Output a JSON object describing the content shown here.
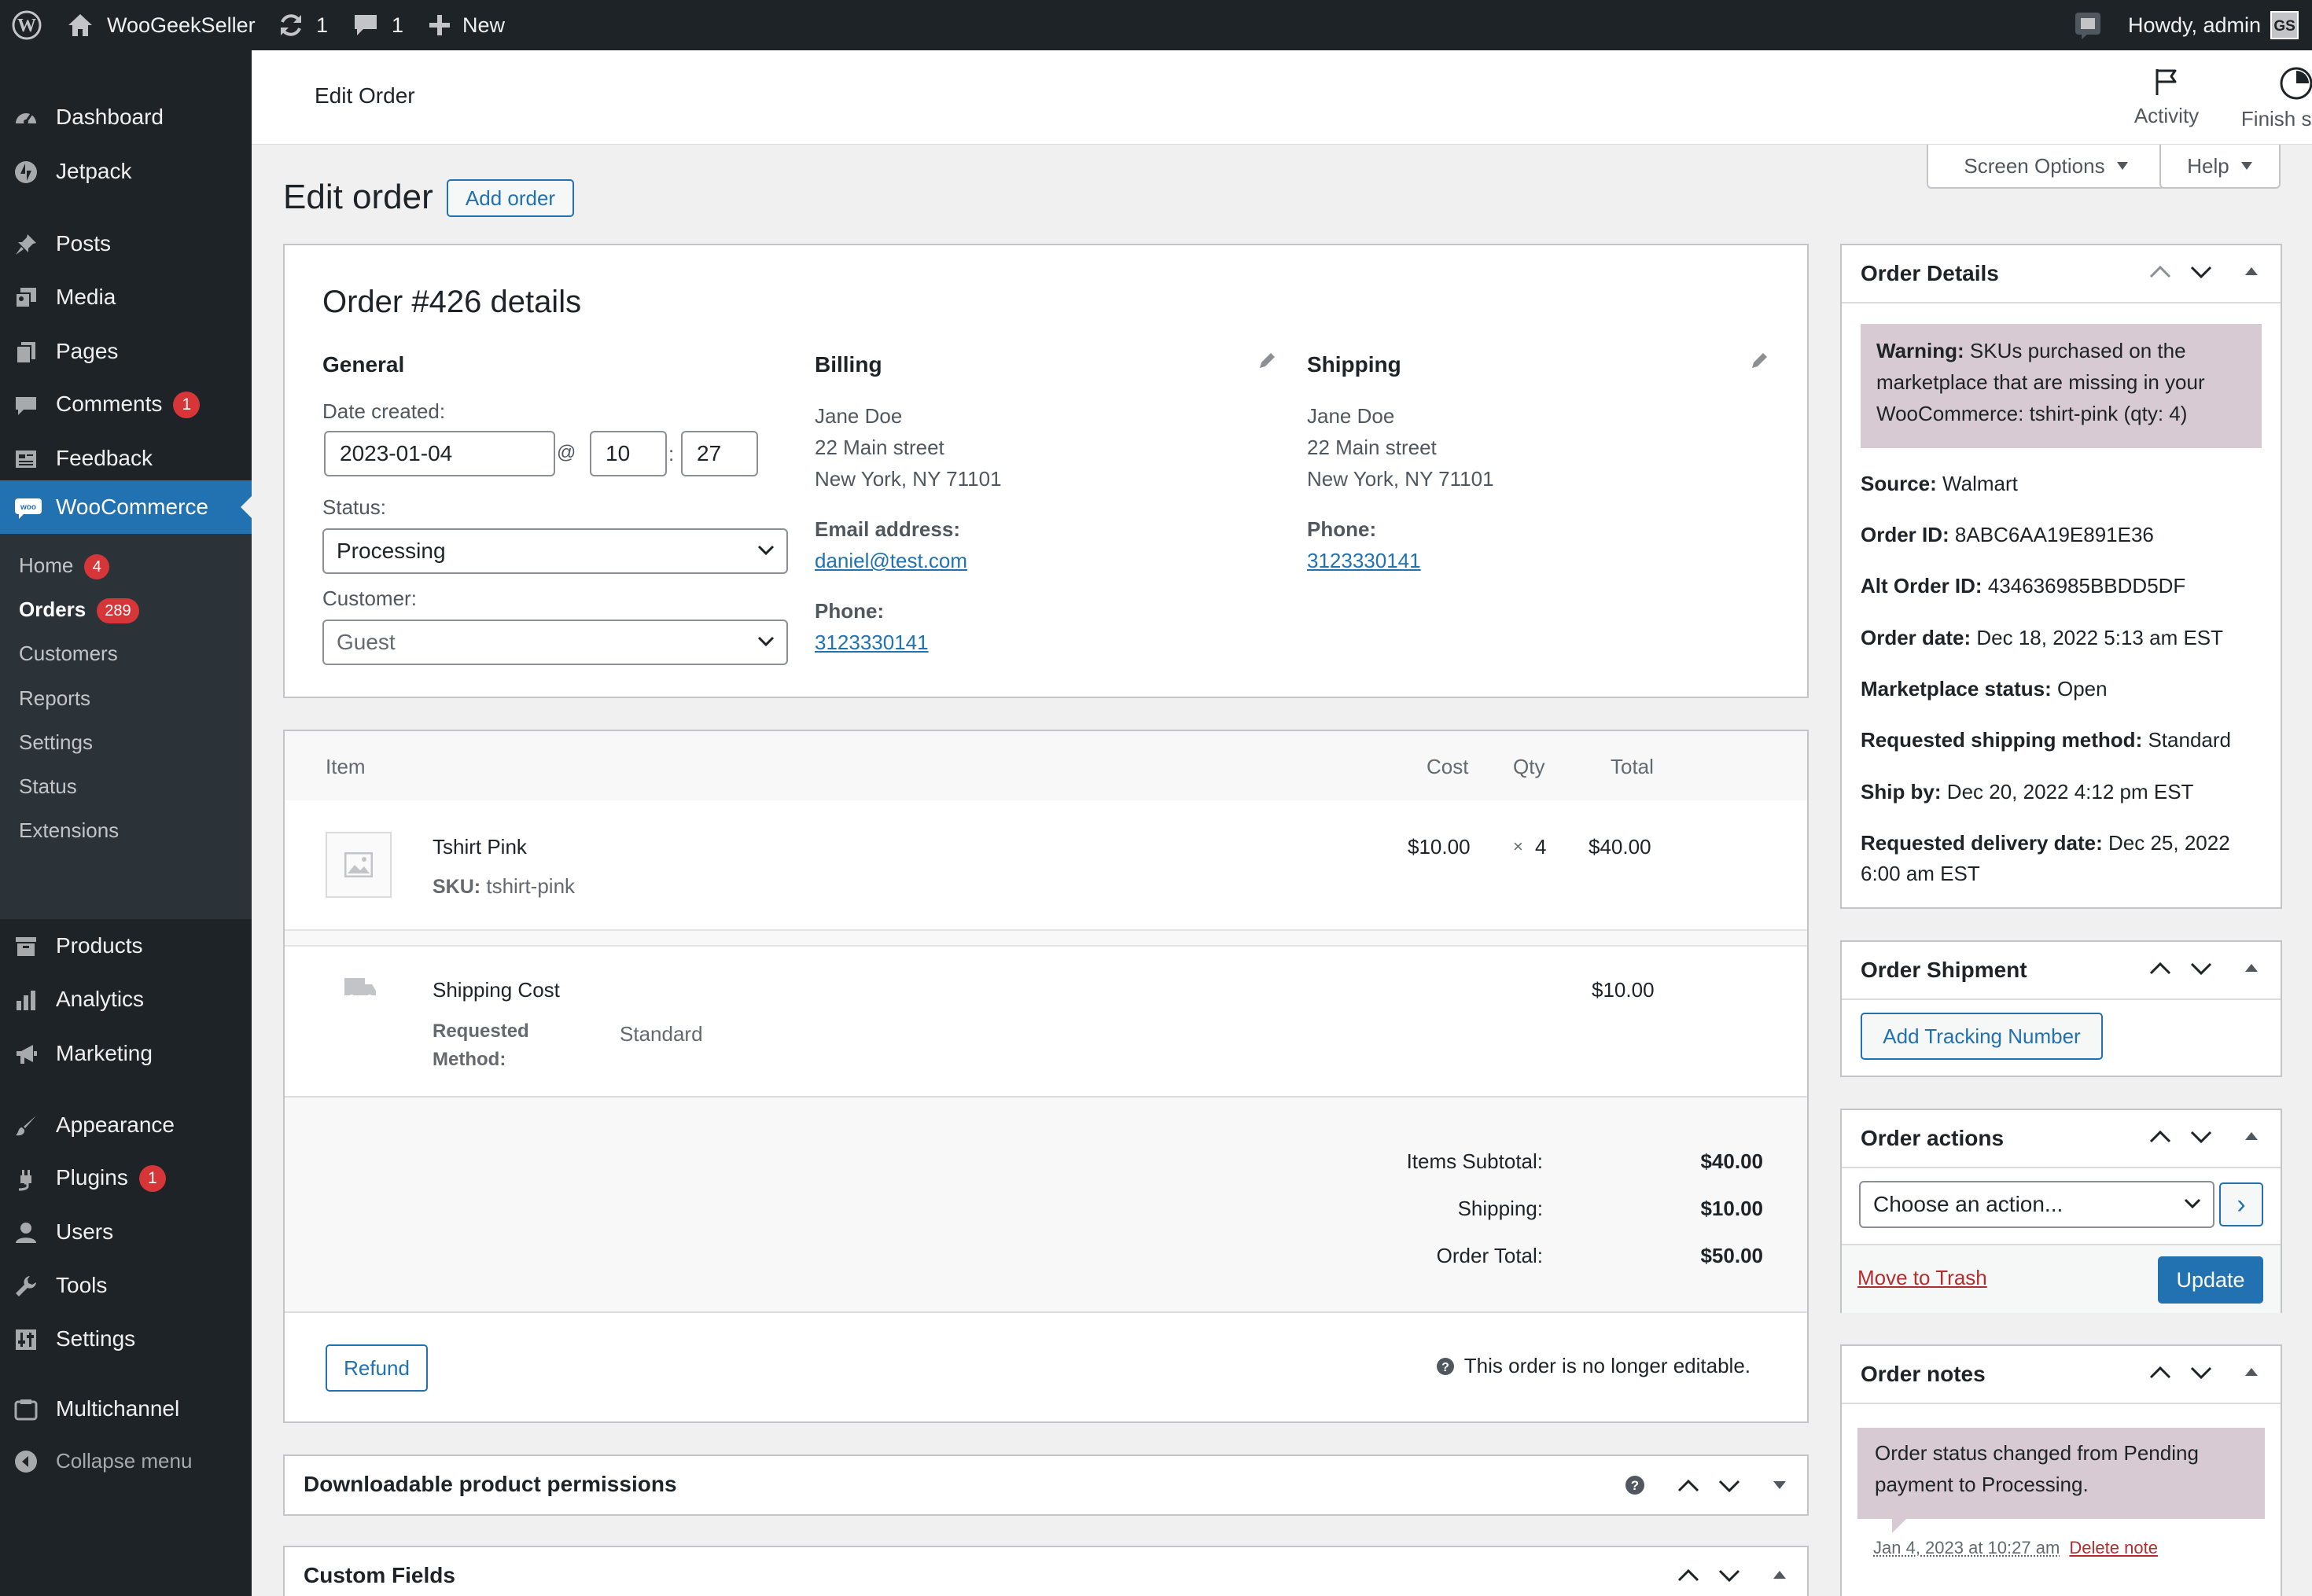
{
  "admin_bar": {
    "site_name": "WooGeekSeller",
    "updates_count": "1",
    "comments_count": "1",
    "new_label": "New",
    "howdy": "Howdy, admin",
    "avatar_initials": "GS"
  },
  "sidebar": {
    "items": [
      {
        "label": "Dashboard",
        "icon": "dashboard-icon"
      },
      {
        "label": "Jetpack",
        "icon": "jetpack-icon"
      },
      {
        "label": "Posts",
        "icon": "pin-icon"
      },
      {
        "label": "Media",
        "icon": "media-icon"
      },
      {
        "label": "Pages",
        "icon": "pages-icon"
      },
      {
        "label": "Comments",
        "icon": "comment-icon",
        "badge": "1"
      },
      {
        "label": "Feedback",
        "icon": "feedback-icon"
      },
      {
        "label": "WooCommerce",
        "icon": "woo-icon"
      },
      {
        "label": "Products",
        "icon": "products-icon"
      },
      {
        "label": "Analytics",
        "icon": "analytics-icon"
      },
      {
        "label": "Marketing",
        "icon": "megaphone-icon"
      },
      {
        "label": "Appearance",
        "icon": "brush-icon"
      },
      {
        "label": "Plugins",
        "icon": "plugin-icon",
        "badge": "1"
      },
      {
        "label": "Users",
        "icon": "user-icon"
      },
      {
        "label": "Tools",
        "icon": "wrench-icon"
      },
      {
        "label": "Settings",
        "icon": "settings-icon"
      },
      {
        "label": "Multichannel",
        "icon": "multichannel-icon"
      },
      {
        "label": "Collapse menu",
        "icon": "collapse-icon"
      }
    ],
    "woo_submenu": [
      {
        "label": "Home",
        "badge": "4"
      },
      {
        "label": "Orders",
        "badge": "289"
      },
      {
        "label": "Customers"
      },
      {
        "label": "Reports"
      },
      {
        "label": "Settings"
      },
      {
        "label": "Status"
      },
      {
        "label": "Extensions"
      }
    ]
  },
  "header": {
    "title": "Edit Order",
    "activity_label": "Activity",
    "finish_setup_label": "Finish setup"
  },
  "screen_options_label": "Screen Options",
  "help_label": "Help",
  "page": {
    "heading": "Edit order",
    "add_order_label": "Add order"
  },
  "order": {
    "title": "Order #426 details",
    "general": {
      "heading": "General",
      "date_label": "Date created:",
      "date": "2023-01-04",
      "at": "@",
      "hour": "10",
      "colon": ":",
      "minute": "27",
      "status_label": "Status:",
      "status": "Processing",
      "customer_label": "Customer:",
      "customer": "Guest"
    },
    "billing": {
      "heading": "Billing",
      "name": "Jane Doe",
      "street": "22 Main street",
      "city": "New York, NY 71101",
      "email_label": "Email address:",
      "email": "daniel@test.com",
      "phone_label": "Phone:",
      "phone": "3123330141"
    },
    "shipping": {
      "heading": "Shipping",
      "name": "Jane Doe",
      "street": "22 Main street",
      "city": "New York, NY 71101",
      "phone_label": "Phone:",
      "phone": "3123330141"
    }
  },
  "items_table": {
    "headers": {
      "item": "Item",
      "cost": "Cost",
      "qty": "Qty",
      "total": "Total"
    },
    "line_item": {
      "name": "Tshirt Pink",
      "sku_label": "SKU:",
      "sku": "tshirt-pink",
      "cost": "$10.00",
      "times": "×",
      "qty": "4",
      "total": "$40.00"
    },
    "shipping_item": {
      "name": "Shipping Cost",
      "method_label_1": "Requested",
      "method_label_2": "Method:",
      "method": "Standard",
      "total": "$10.00"
    },
    "totals": {
      "subtotal_label": "Items Subtotal:",
      "subtotal": "$40.00",
      "shipping_label": "Shipping:",
      "shipping": "$10.00",
      "total_label": "Order Total:",
      "total": "$50.00"
    },
    "refund_label": "Refund",
    "not_editable": "This order is no longer editable."
  },
  "downloadable": {
    "title": "Downloadable product permissions"
  },
  "custom_fields": {
    "title": "Custom Fields"
  },
  "order_details_box": {
    "title": "Order Details",
    "warning_strong": "Warning:",
    "warning_1": "SKUs purchased on the",
    "warning_2": "marketplace that are missing in your",
    "warning_3": "WooCommerce: tshirt-pink (qty: 4)",
    "fields": [
      {
        "label": "Source:",
        "value": "Walmart"
      },
      {
        "label": "Order ID:",
        "value": "8ABC6AA19E891E36"
      },
      {
        "label": "Alt Order ID:",
        "value": "434636985BBDD5DF"
      },
      {
        "label": "Order date:",
        "value": "Dec 18, 2022 5:13 am EST"
      },
      {
        "label": "Marketplace status:",
        "value": "Open"
      },
      {
        "label": "Requested shipping method:",
        "value": "Standard"
      },
      {
        "label": "Ship by:",
        "value": "Dec 20, 2022 4:12 pm EST"
      },
      {
        "label": "Requested delivery date:",
        "value": "Dec 25, 2022"
      }
    ],
    "delivery_cont": "6:00 am EST"
  },
  "order_shipment_box": {
    "title": "Order Shipment",
    "add_tracking_label": "Add Tracking Number"
  },
  "order_actions_box": {
    "title": "Order actions",
    "action_placeholder": "Choose an action...",
    "go_label": "›",
    "trash_label": "Move to Trash",
    "update_label": "Update"
  },
  "order_notes_box": {
    "title": "Order notes",
    "note_1": "Order status changed from Pending",
    "note_2": "payment to Processing.",
    "note_date": "Jan 4, 2023 at 10:27 am",
    "delete_label": "Delete note"
  }
}
